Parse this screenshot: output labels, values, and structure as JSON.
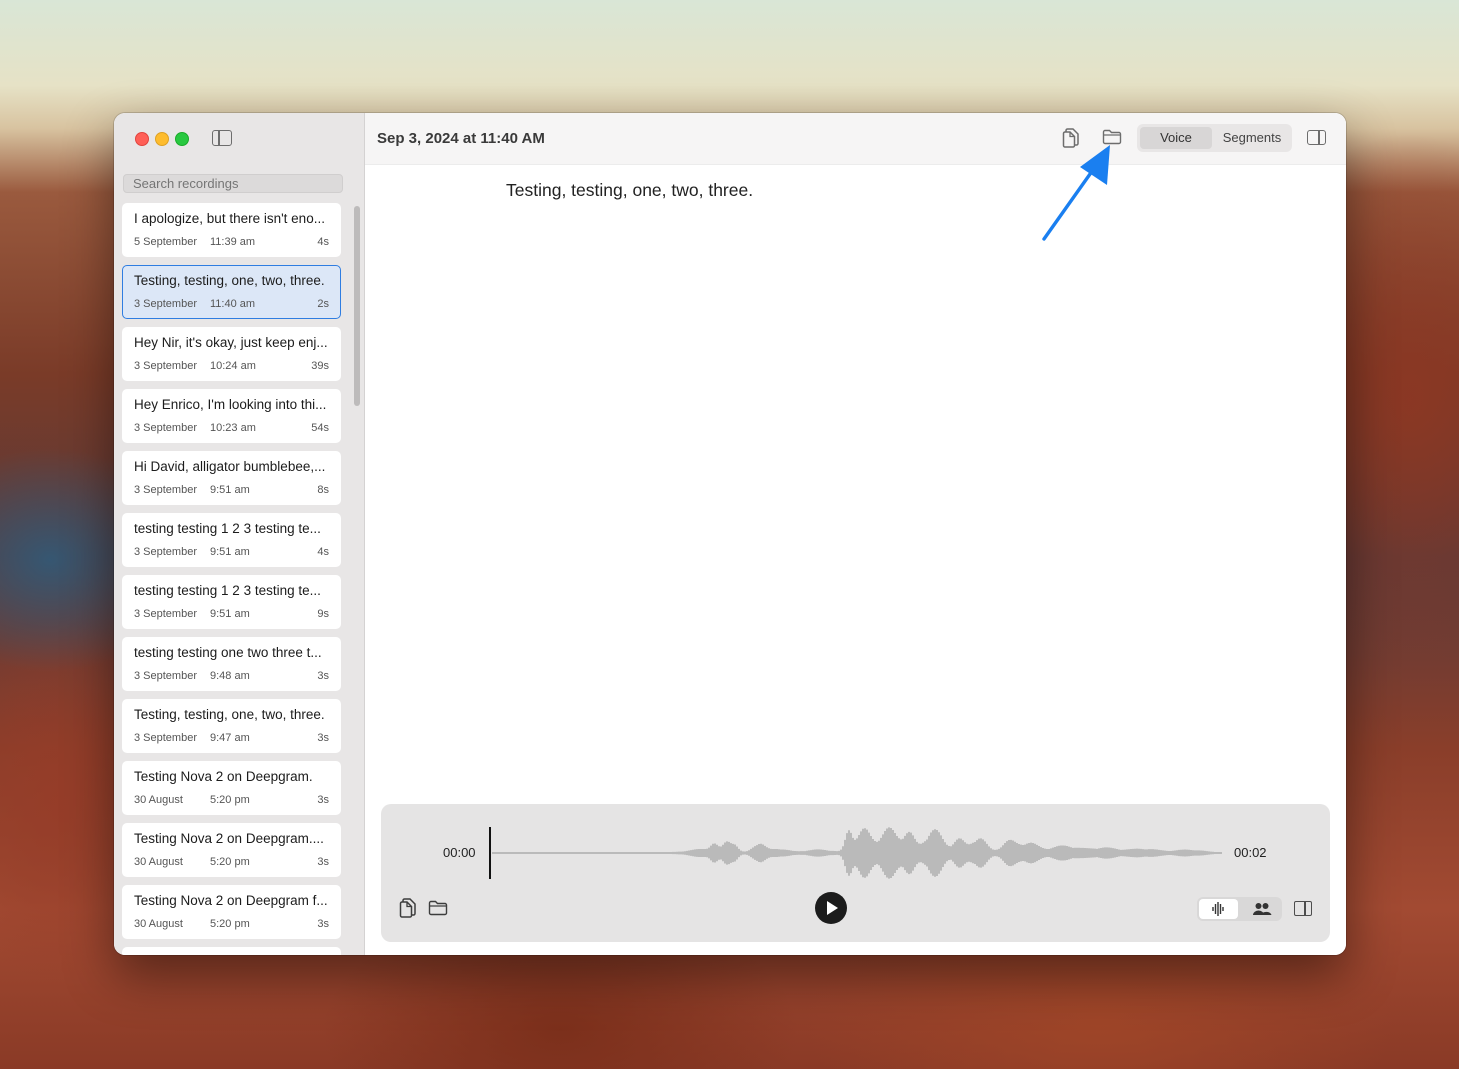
{
  "window": {
    "title": "Sep 3, 2024 at 11:40 AM"
  },
  "sidebar": {
    "search_placeholder": "Search recordings",
    "items": [
      {
        "title": "I apologize, but there isn't eno...",
        "date": "5 September",
        "time": "11:39 am",
        "duration": "4s",
        "selected": false
      },
      {
        "title": "Testing, testing, one, two, three.",
        "date": "3 September",
        "time": "11:40 am",
        "duration": "2s",
        "selected": true
      },
      {
        "title": "Hey Nir, it's okay, just keep enj...",
        "date": "3 September",
        "time": "10:24 am",
        "duration": "39s",
        "selected": false
      },
      {
        "title": "Hey Enrico, I'm looking into thi...",
        "date": "3 September",
        "time": "10:23 am",
        "duration": "54s",
        "selected": false
      },
      {
        "title": "Hi David, alligator bumblebee,...",
        "date": "3 September",
        "time": "9:51 am",
        "duration": "8s",
        "selected": false
      },
      {
        "title": "testing testing 1 2 3 testing te...",
        "date": "3 September",
        "time": "9:51 am",
        "duration": "4s",
        "selected": false
      },
      {
        "title": "testing testing 1 2 3 testing te...",
        "date": "3 September",
        "time": "9:51 am",
        "duration": "9s",
        "selected": false
      },
      {
        "title": "testing testing one two three t...",
        "date": "3 September",
        "time": "9:48 am",
        "duration": "3s",
        "selected": false
      },
      {
        "title": "Testing, testing, one, two, three.",
        "date": "3 September",
        "time": "9:47 am",
        "duration": "3s",
        "selected": false
      },
      {
        "title": "Testing Nova 2 on Deepgram.",
        "date": "30 August",
        "time": "5:20 pm",
        "duration": "3s",
        "selected": false
      },
      {
        "title": "Testing Nova 2 on Deepgram....",
        "date": "30 August",
        "time": "5:20 pm",
        "duration": "3s",
        "selected": false
      },
      {
        "title": "Testing Nova 2 on Deepgram f...",
        "date": "30 August",
        "time": "5:20 pm",
        "duration": "3s",
        "selected": false
      },
      {
        "title": "",
        "date": "",
        "time": "",
        "duration": "",
        "selected": false
      }
    ]
  },
  "toolbar": {
    "tabs": [
      {
        "label": "Voice",
        "active": true
      },
      {
        "label": "Segments",
        "active": false
      }
    ]
  },
  "transcript": {
    "text": "Testing, testing, one, two, three."
  },
  "player": {
    "current_time": "00:00",
    "total_time": "00:02",
    "progress": 0.0,
    "view_mode": "waveform"
  },
  "icons": {
    "copy": "copy-documents-icon",
    "folder": "folder-icon",
    "sidebar_toggle": "sidebar-toggle-icon",
    "inspector": "inspector-panel-icon",
    "play": "play-icon",
    "waveform": "waveform-icon",
    "people": "people-icon"
  },
  "colors": {
    "accent": "#2f7de1",
    "annotation_arrow": "#1a7ff0",
    "traffic_red": "#ff5f57",
    "traffic_yellow": "#febc2e",
    "traffic_green": "#28c840"
  }
}
